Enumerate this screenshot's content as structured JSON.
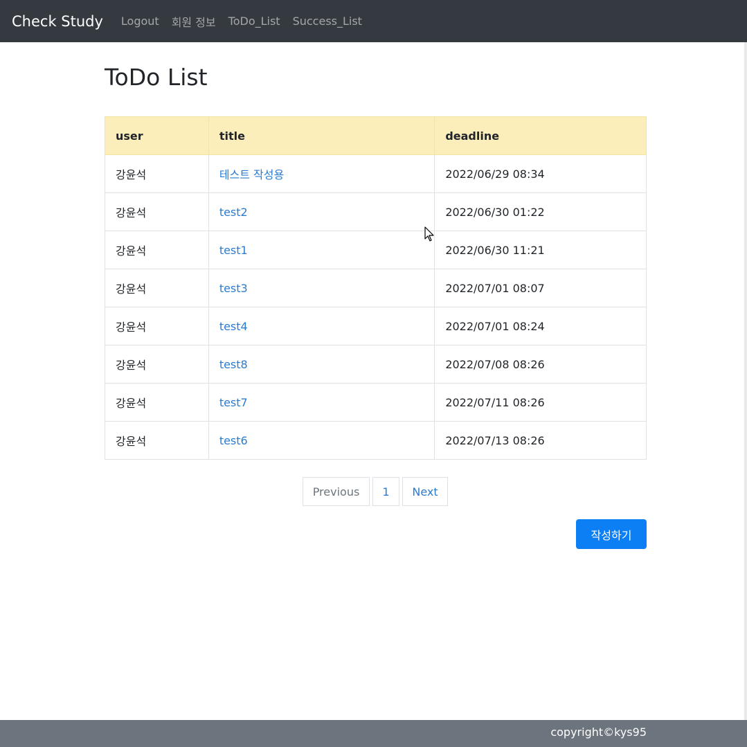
{
  "navbar": {
    "brand": "Check Study",
    "links": [
      {
        "label": "Logout"
      },
      {
        "label": "회원 정보"
      },
      {
        "label": "ToDo_List"
      },
      {
        "label": "Success_List"
      }
    ]
  },
  "main": {
    "title": "ToDo List",
    "table": {
      "headers": {
        "user": "user",
        "title": "title",
        "deadline": "deadline"
      },
      "rows": [
        {
          "user": "강윤석",
          "title": "테스트 작성용",
          "deadline": "2022/06/29 08:34"
        },
        {
          "user": "강윤석",
          "title": "test2",
          "deadline": "2022/06/30 01:22"
        },
        {
          "user": "강윤석",
          "title": "test1",
          "deadline": "2022/06/30 11:21"
        },
        {
          "user": "강윤석",
          "title": "test3",
          "deadline": "2022/07/01 08:07"
        },
        {
          "user": "강윤석",
          "title": "test4",
          "deadline": "2022/07/01 08:24"
        },
        {
          "user": "강윤석",
          "title": "test8",
          "deadline": "2022/07/08 08:26"
        },
        {
          "user": "강윤석",
          "title": "test7",
          "deadline": "2022/07/11 08:26"
        },
        {
          "user": "강윤석",
          "title": "test6",
          "deadline": "2022/07/13 08:26"
        }
      ]
    },
    "pagination": {
      "previous": "Previous",
      "current_page": "1",
      "next": "Next"
    },
    "write_button": "작성하기"
  },
  "footer": {
    "text": "copyright©kys95"
  },
  "colors": {
    "navbar_bg": "#343a40",
    "table_header_bg": "#fbeeba",
    "link": "#2a7bd0",
    "primary_button": "#0d7ff5",
    "footer_bg": "#6c757d"
  }
}
